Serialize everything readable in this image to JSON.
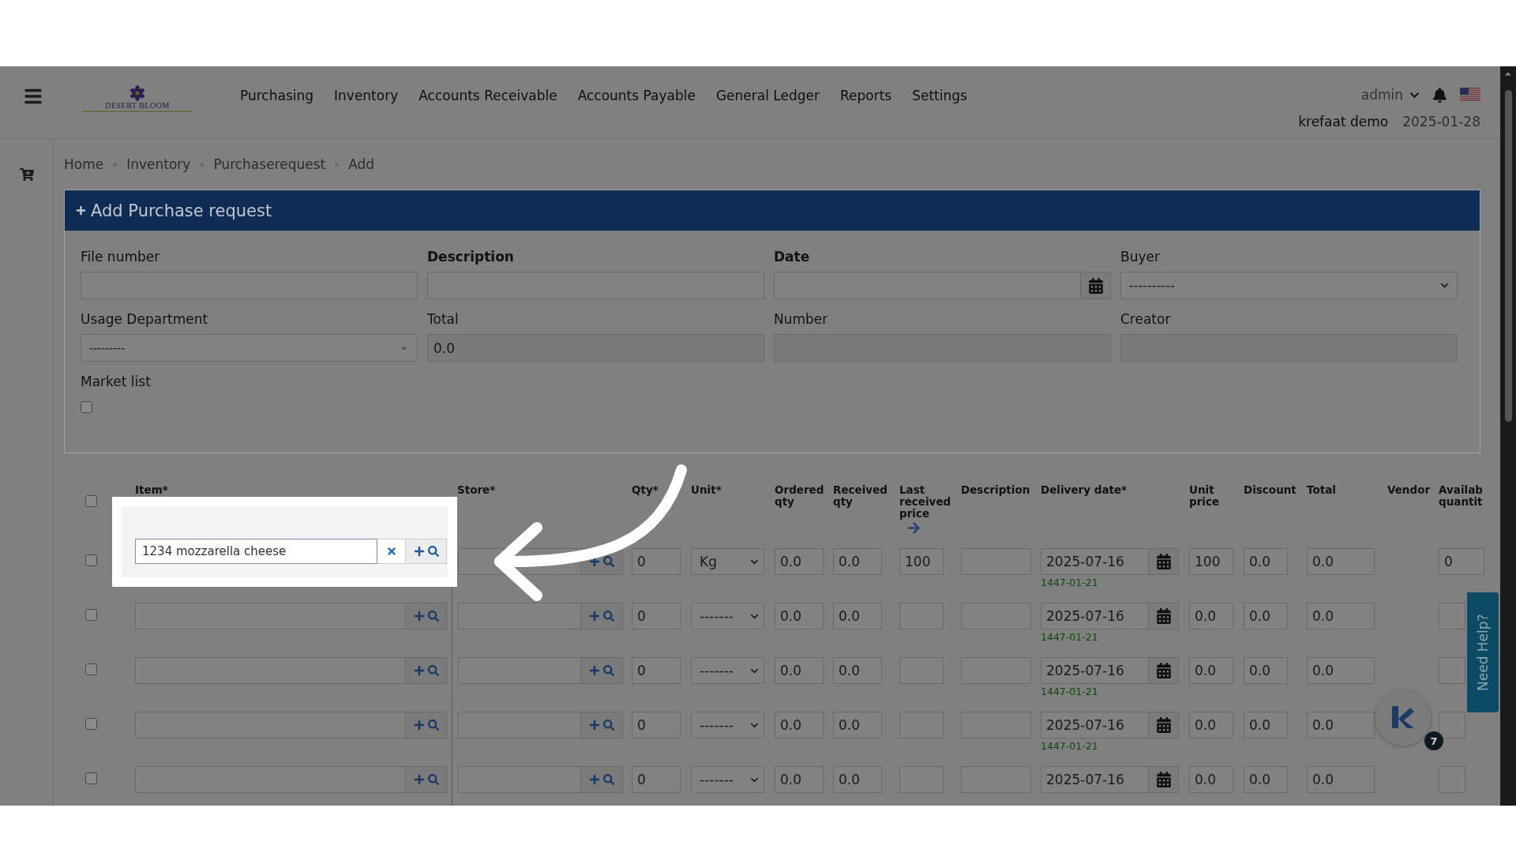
{
  "header": {
    "logo_text": "DESERT BLOOM",
    "nav": [
      "Purchasing",
      "Inventory",
      "Accounts Receivable",
      "Accounts Payable",
      "General Ledger",
      "Reports",
      "Settings"
    ],
    "user": "admin",
    "account": "krefaat demo",
    "date": "2025-01-28"
  },
  "breadcrumb": [
    "Home",
    "Inventory",
    "Purchaserequest",
    "Add"
  ],
  "panel": {
    "title": "Add Purchase request"
  },
  "form": [
    {
      "label": "File number",
      "kind": "text",
      "bold": false
    },
    {
      "label": "Description",
      "kind": "text",
      "bold": true
    },
    {
      "label": "Date",
      "kind": "date",
      "bold": true
    },
    {
      "label": "Buyer",
      "kind": "select",
      "bold": false,
      "value": "----------"
    },
    {
      "label": "Usage Department",
      "kind": "combo",
      "bold": false,
      "value": "---------"
    },
    {
      "label": "Total",
      "kind": "readonly",
      "bold": false,
      "value": "0.0"
    },
    {
      "label": "Number",
      "kind": "readonly",
      "bold": false
    },
    {
      "label": "Creator",
      "kind": "readonly",
      "bold": false
    },
    {
      "label": "Market list",
      "kind": "checkbox",
      "bold": false,
      "checked": false
    }
  ],
  "table": {
    "all_checked": false,
    "columns": [
      {
        "label": "Item*"
      },
      {
        "label": "Store*"
      },
      {
        "label": "Qty*"
      },
      {
        "label": "Unit*"
      },
      {
        "label": "Ordered qty"
      },
      {
        "label": "Received qty"
      },
      {
        "label": "Last received price",
        "arrow_button": true
      },
      {
        "label": "Description"
      },
      {
        "label": "Delivery date*"
      },
      {
        "label": "Unit price"
      },
      {
        "label": "Discount"
      },
      {
        "label": "Total"
      },
      {
        "label": "Vendor"
      },
      {
        "label": "Availab quantit"
      }
    ],
    "rows": [
      {
        "checked": false,
        "spotlight": true,
        "qty": "0",
        "unit": "Kg",
        "ordered": "0.0",
        "received": "0.0",
        "last_price": "100",
        "delivery": "2025-07-16",
        "hijri": "1447-01-21",
        "unit_price": "100",
        "discount": "0.0",
        "total": "0.0",
        "available": "0"
      },
      {
        "checked": false,
        "spotlight": false,
        "qty": "0",
        "unit": "-------",
        "ordered": "0.0",
        "received": "0.0",
        "delivery": "2025-07-16",
        "hijri": "1447-01-21",
        "unit_price": "0.0",
        "discount": "0.0",
        "total": "0.0"
      },
      {
        "checked": false,
        "spotlight": false,
        "qty": "0",
        "unit": "-------",
        "ordered": "0.0",
        "received": "0.0",
        "delivery": "2025-07-16",
        "hijri": "1447-01-21",
        "unit_price": "0.0",
        "discount": "0.0",
        "total": "0.0"
      },
      {
        "checked": false,
        "spotlight": false,
        "qty": "0",
        "unit": "-------",
        "ordered": "0.0",
        "received": "0.0",
        "delivery": "2025-07-16",
        "hijri": "1447-01-21",
        "unit_price": "0.0",
        "discount": "0.0",
        "total": "0.0"
      },
      {
        "checked": false,
        "spotlight": false,
        "qty": "0",
        "unit": "-------",
        "ordered": "0.0",
        "received": "0.0",
        "delivery": "2025-07-16",
        "unit_price": "0.0",
        "discount": "0.0",
        "total": "0.0"
      }
    ]
  },
  "spotlight": {
    "item_value": "1234 mozzarella cheese"
  },
  "help": {
    "label": "Need Help?",
    "badge": "7"
  }
}
